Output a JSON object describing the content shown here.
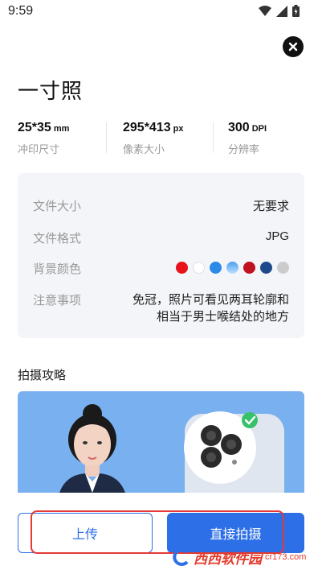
{
  "status_bar": {
    "time": "9:59"
  },
  "page": {
    "title": "一寸照"
  },
  "specs": [
    {
      "value": "25*35",
      "unit": "mm",
      "label": "冲印尺寸"
    },
    {
      "value": "295*413",
      "unit": "px",
      "label": "像素大小"
    },
    {
      "value": "300",
      "unit": "DPI",
      "label": "分辨率"
    }
  ],
  "info": {
    "file_size": {
      "key": "文件大小",
      "value": "无要求"
    },
    "file_format": {
      "key": "文件格式",
      "value": "JPG"
    },
    "background": {
      "key": "背景颜色",
      "colors": [
        "#e8121a",
        "#ffffff",
        "#2b8ae8",
        "#7bbcf4",
        "#c1121f",
        "#1e4a8c",
        "#cccccc"
      ]
    },
    "notes": {
      "key": "注意事项",
      "value": "免冠，照片可看见两耳轮廓和相当于男士喉结处的地方"
    }
  },
  "guide": {
    "title": "拍摄攻略"
  },
  "actions": {
    "upload": "上传",
    "shoot": "直接拍摄"
  },
  "watermark": {
    "brand": "西西软件园",
    "domain": "cr173.com"
  },
  "colors": {
    "accent": "#2d6fe6",
    "card_bg": "#f4f5f8",
    "banner_bg": "#79b0f0",
    "highlight": "#e53935"
  }
}
